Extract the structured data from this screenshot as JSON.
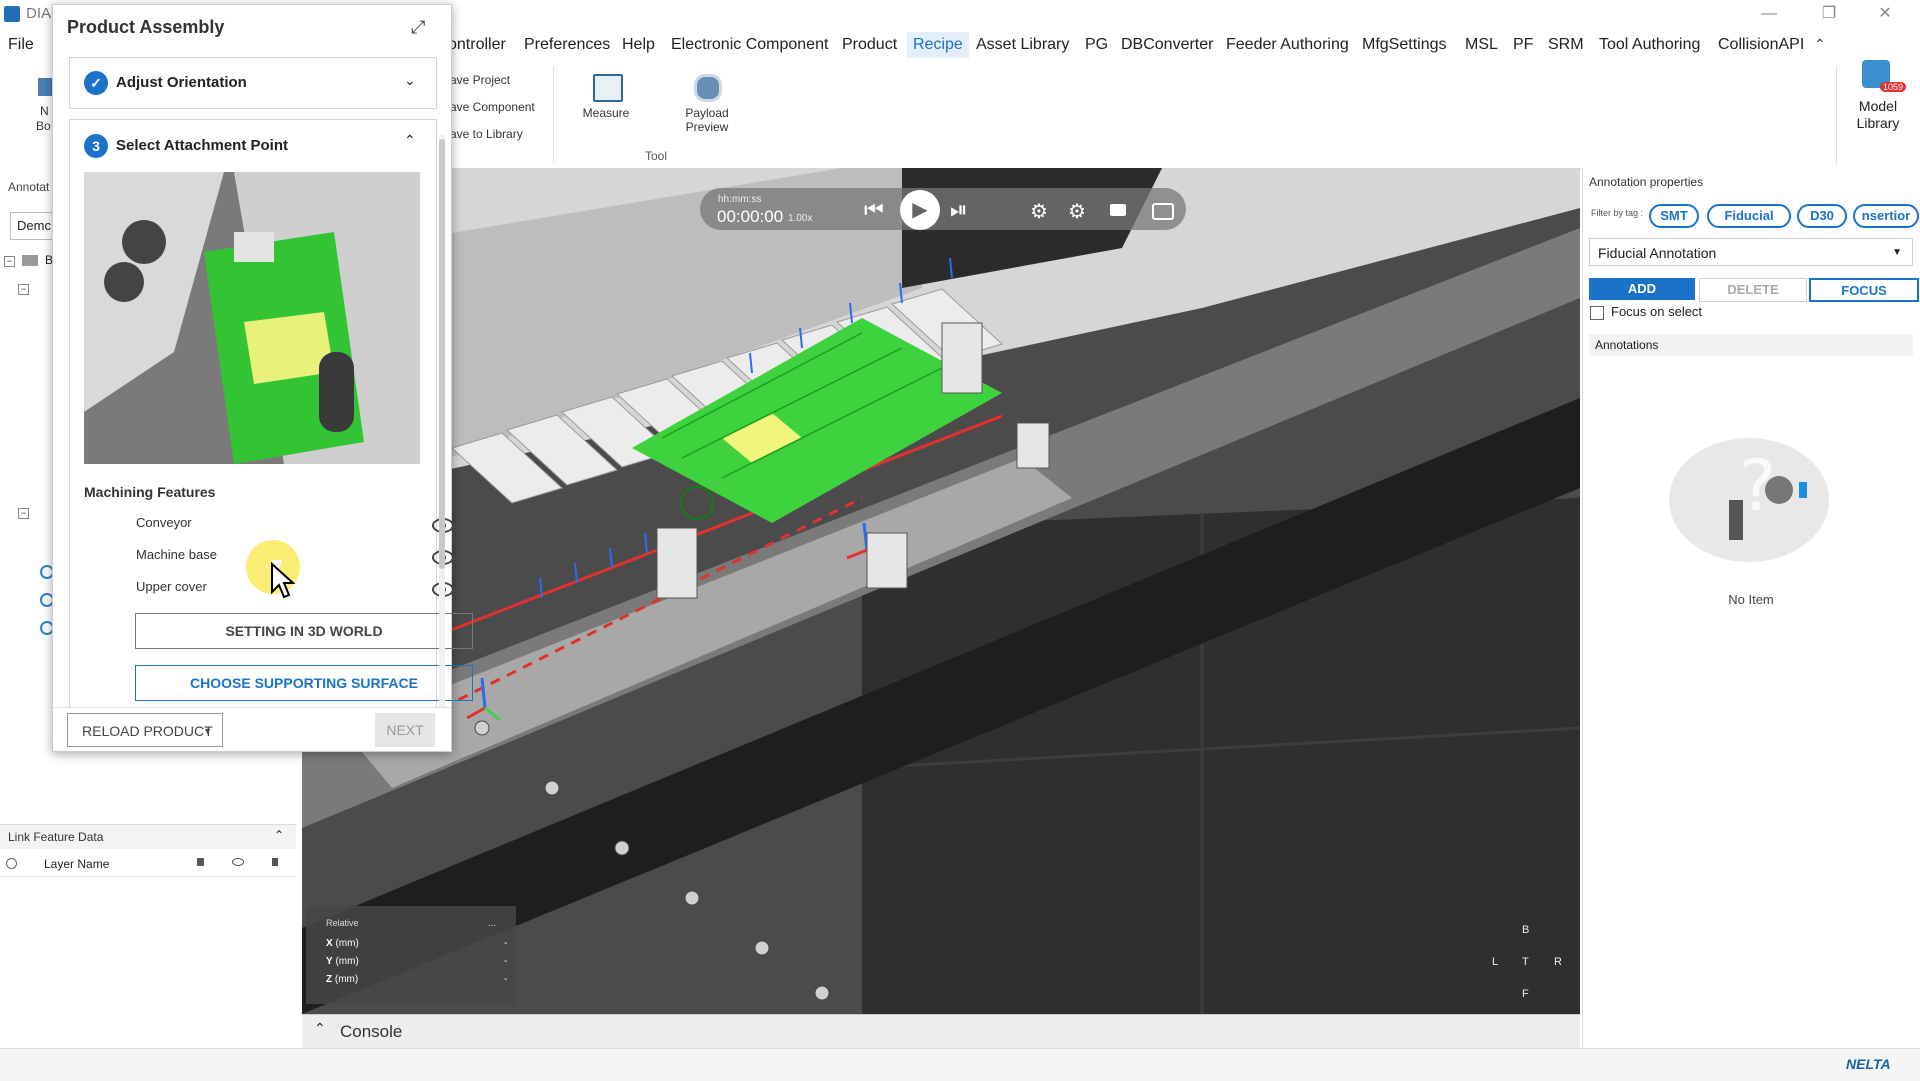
{
  "app": {
    "title": "DIA",
    "menu": [
      "File",
      "Controller",
      "Preferences",
      "Help",
      "Electronic Component",
      "Product",
      "Recipe",
      "Asset Library",
      "PG",
      "DBConverter",
      "Feeder Authoring",
      "MfgSettings",
      "MSL",
      "PF",
      "SRM",
      "Tool Authoring",
      "CollisionAPI"
    ],
    "file_label": "File",
    "controller_label": "ontroller",
    "active_menu": "Recipe"
  },
  "ribbon": {
    "save_project": "ave Project",
    "save_component": "ave Component",
    "save_to_library": "ave to Library",
    "measure": "Measure",
    "payload_preview_1": "Payload",
    "payload_preview_2": "Preview",
    "tool_group": "Tool",
    "model_library_1": "Model",
    "model_library_2": "Library",
    "model_library_badge": "1059",
    "new_label": "N",
    "new_label2": "Bo"
  },
  "left": {
    "annotations_header": "Annotat",
    "demo_dropdown": "Demc",
    "tree_root_label": "B",
    "link_feature_data": "Link Feature Data",
    "layer_name": "Layer Name"
  },
  "dialog": {
    "title": "Product Assembly",
    "step1_label": "Adjust Orientation",
    "step3_number": "3",
    "step3_label": "Select Attachment Point",
    "machining_features_title": "Machining Features",
    "features": [
      "Conveyor",
      "Machine base",
      "Upper cover"
    ],
    "setting_3d_world": "SETTING IN 3D WORLD",
    "choose_supporting_surface": "CHOOSE SUPPORTING SURFACE",
    "reload_product": "RELOAD PRODUCT",
    "next": "NEXT"
  },
  "playback": {
    "time_format": "hh:mm:ss",
    "time_value": "00:00:00",
    "speed": "1.00x"
  },
  "coords": {
    "mode": "Relative",
    "x_label": "X",
    "y_label": "Y",
    "z_label": "Z",
    "unit": "(mm)",
    "x_value": "-",
    "y_value": "-",
    "z_value": "-",
    "more": "..."
  },
  "view_cube": {
    "top": "B",
    "left": "L",
    "center": "T",
    "right": "R",
    "bottom": "F"
  },
  "console": {
    "label": "Console"
  },
  "right": {
    "header": "Annotation properties",
    "filter_label": "Filter by tag :",
    "tags": [
      "SMT",
      "Fiducial",
      "D30",
      "nsertior"
    ],
    "annotation_type": "Fiducial Annotation",
    "add": "ADD",
    "delete": "DELETE",
    "focus": "FOCUS",
    "focus_on_select": "Focus on select",
    "annotations": "Annotations",
    "no_item": "No Item"
  },
  "status": {
    "brand": "NELTA"
  },
  "colors": {
    "accent": "#1a73c9",
    "pcb_green": "#3fd23f",
    "conveyor_red": "#e23030"
  }
}
